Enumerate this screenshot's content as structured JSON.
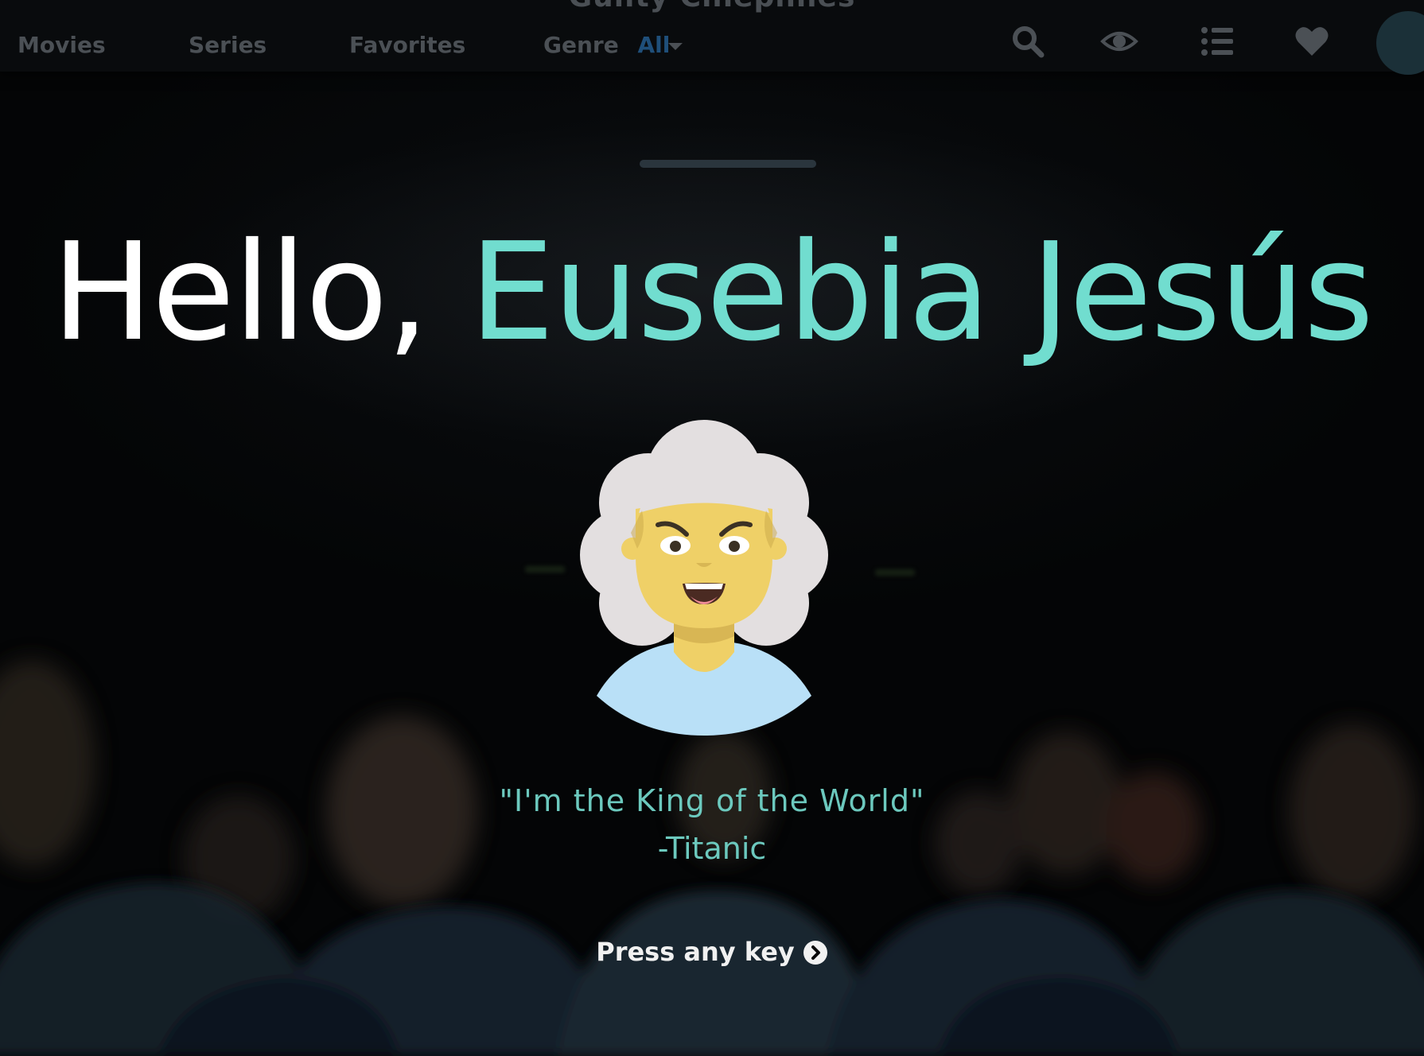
{
  "app": {
    "title": "Guilty Cinephiles"
  },
  "nav": {
    "movies": "Movies",
    "series": "Series",
    "favorites": "Favorites",
    "genre_label": "Genre",
    "genre_value": "All",
    "icons": [
      "search-icon",
      "eye-icon",
      "list-icon",
      "heart-icon",
      "profile-avatar"
    ]
  },
  "loading": {
    "progress": 1.0
  },
  "greeting": {
    "hello": "Hello,",
    "name": "Eusebia Jesús"
  },
  "quote": {
    "text": "\"I'm the King of the World\"",
    "source": "-Titanic"
  },
  "cta": {
    "label": "Press any key"
  },
  "colors": {
    "accent": "#71ddcf",
    "quote": "#6cc9be",
    "genre_value": "#1f4f7a",
    "background": "#050607"
  }
}
